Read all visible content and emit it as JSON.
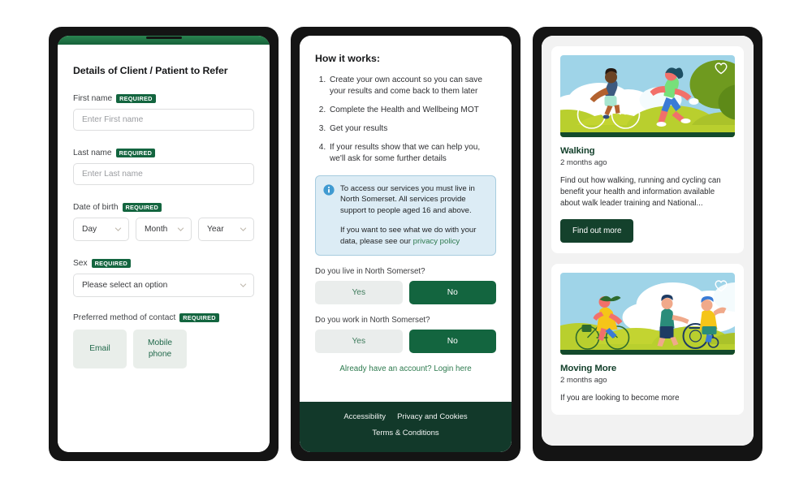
{
  "panel1": {
    "title": "Details of Client / Patient to Refer",
    "required_badge": "REQUIRED",
    "fields": {
      "first_name": {
        "label": "First name",
        "placeholder": "Enter First name"
      },
      "last_name": {
        "label": "Last name",
        "placeholder": "Enter Last name"
      },
      "dob": {
        "label": "Date of birth",
        "day": "Day",
        "month": "Month",
        "year": "Year"
      },
      "sex": {
        "label": "Sex",
        "value": "Please select an option"
      },
      "contact": {
        "label": "Preferred method of contact",
        "option_email": "Email",
        "option_mobile": "Mobile phone"
      }
    }
  },
  "panel2": {
    "title": "How it works:",
    "steps": [
      "Create your own account so you can save your results and come back to them later",
      "Complete the Health and Wellbeing MOT",
      "Get your results",
      "If your results show that we can help you, we'll ask for some further details"
    ],
    "info": {
      "paragraph1": "To access our services you must live in North Somerset. All services provide support to people aged 16 and above.",
      "paragraph2_prefix": "If you want to see what we do with your data, please see our ",
      "paragraph2_link": "privacy policy"
    },
    "questions": [
      {
        "label": "Do you live in North Somerset?",
        "yes": "Yes",
        "no": "No",
        "selected": "No"
      },
      {
        "label": "Do you work in North Somerset?",
        "yes": "Yes",
        "no": "No",
        "selected": "No"
      }
    ],
    "login_link": "Already have an account? Login here",
    "footer": {
      "accessibility": "Accessibility",
      "privacy": "Privacy and Cookies",
      "terms": "Terms & Conditions"
    }
  },
  "panel3": {
    "cards": [
      {
        "title": "Walking",
        "date": "2 months ago",
        "description": "Find out how walking, running and cycling can benefit your health and information available about walk leader training and National...",
        "button": "Find out more"
      },
      {
        "title": "Moving More",
        "date": "2 months ago",
        "description": "If you are looking to become more"
      }
    ]
  },
  "colors": {
    "brand_green": "#13653f",
    "dark_green": "#14412c",
    "topbar_green": "#1f7044",
    "link_green": "#2d7a4e",
    "info_blue_bg": "#dcecf5",
    "info_blue_border": "#a7ccdf",
    "bezel_black": "#141414"
  }
}
